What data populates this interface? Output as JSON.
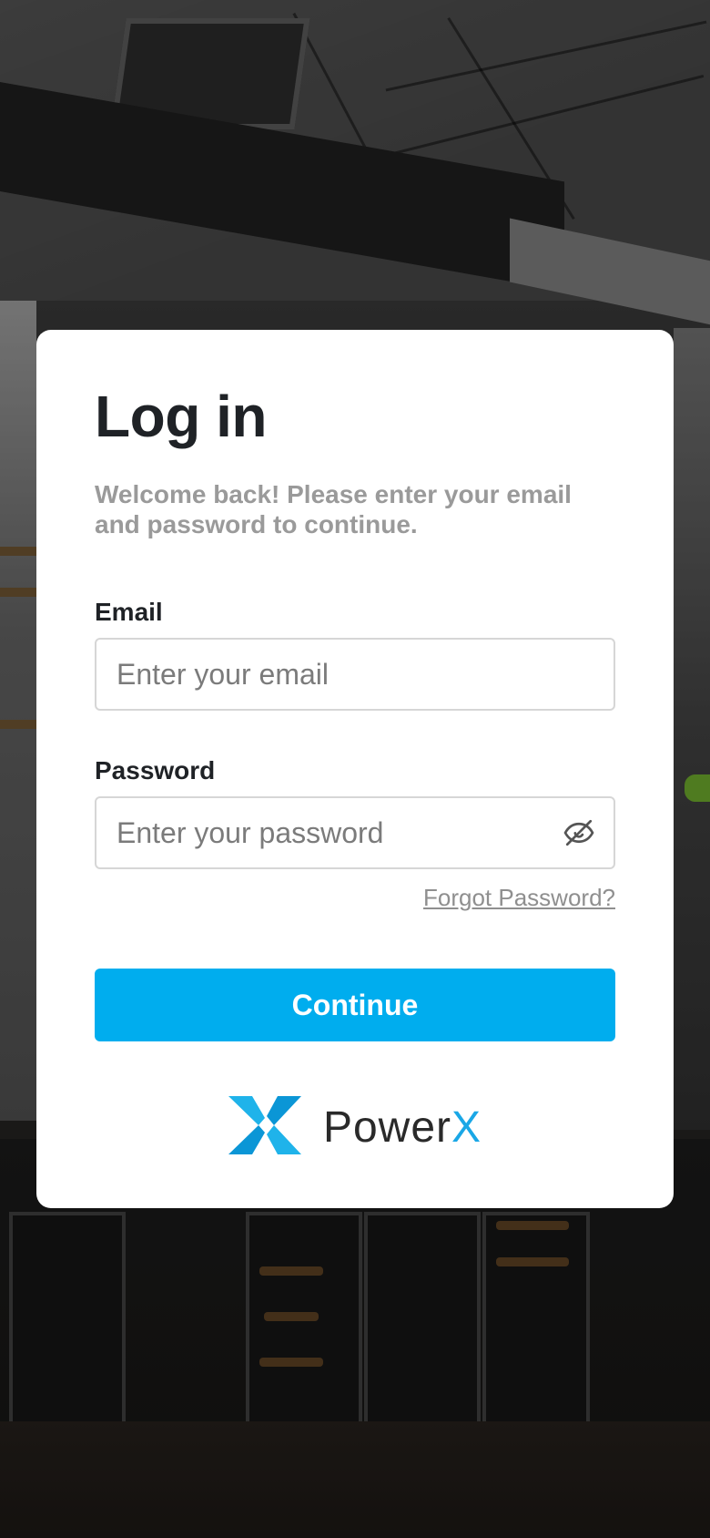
{
  "login": {
    "title": "Log in",
    "subtitle": "Welcome back! Please enter your email and password to continue.",
    "email": {
      "label": "Email",
      "placeholder": "Enter your email",
      "value": ""
    },
    "password": {
      "label": "Password",
      "placeholder": "Enter your password",
      "value": "",
      "toggle_icon": "eye-off-icon"
    },
    "forgot_password": "Forgot Password?",
    "continue_label": "Continue"
  },
  "brand": {
    "name_main": "Power",
    "name_accent": "X",
    "logo_icon": "powerx-logo-icon",
    "accent_color": "#00adee"
  },
  "colors": {
    "primary_button": "#00adee",
    "title_text": "#1f2226",
    "muted_text": "#9a9a9a",
    "card_background": "#ffffff"
  }
}
